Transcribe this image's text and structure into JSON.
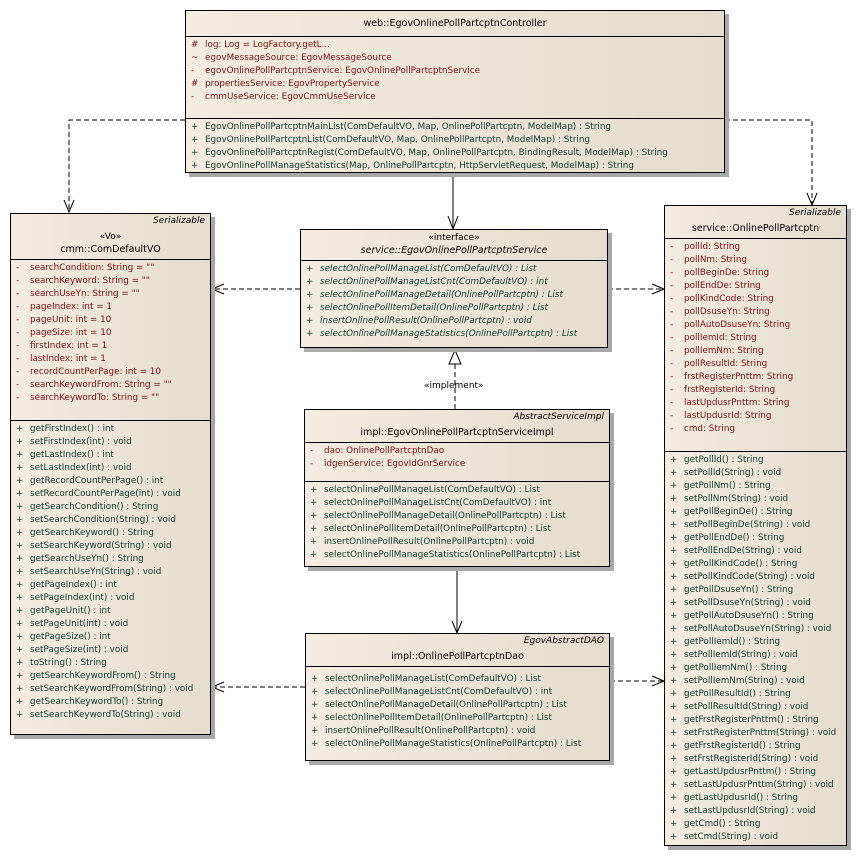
{
  "controller": {
    "name": "web::EgovOnlinePollPartcptnController",
    "attributes": [
      {
        "vis": "#",
        "text": "log:  Log = LogFactory.getL..."
      },
      {
        "vis": "~",
        "text": "egovMessageSource:  EgovMessageSource"
      },
      {
        "vis": "-",
        "text": "egovOnlinePollPartcptnService:  EgovOnlinePollPartcptnService"
      },
      {
        "vis": "#",
        "text": "propertiesService:  EgovPropertyService"
      },
      {
        "vis": "-",
        "text": "cmmUseService:  EgovCmmUseService"
      }
    ],
    "operations": [
      {
        "vis": "+",
        "text": "EgovOnlinePollPartcptnMainList(ComDefaultVO, Map, OnlinePollPartcptn, ModelMap) : String"
      },
      {
        "vis": "+",
        "text": "EgovOnlinePollPartcptnList(ComDefaultVO, Map, OnlinePollPartcptn, ModelMap) : String"
      },
      {
        "vis": "+",
        "text": "EgovOnlinePollPartcptnRegist(ComDefaultVO, Map, OnlinePollPartcptn, BindingResult, ModelMap) : String"
      },
      {
        "vis": "+",
        "text": "EgovOnlinePollManageStatistics(Map, OnlinePollPartcptn, HttpServletRequest, ModelMap) : String"
      }
    ]
  },
  "comDefaultVO": {
    "parent": "Serializable",
    "stereotype": "«Vo»",
    "name": "cmm::ComDefaultVO",
    "attributes": [
      {
        "vis": "-",
        "text": "searchCondition:  String = \"\""
      },
      {
        "vis": "-",
        "text": "searchKeyword:  String = \"\""
      },
      {
        "vis": "-",
        "text": "searchUseYn:  String = \"\""
      },
      {
        "vis": "-",
        "text": "pageIndex:  int = 1"
      },
      {
        "vis": "-",
        "text": "pageUnit:  int = 10"
      },
      {
        "vis": "-",
        "text": "pageSize:  int = 10"
      },
      {
        "vis": "-",
        "text": "firstIndex:  int = 1"
      },
      {
        "vis": "-",
        "text": "lastIndex:  int = 1"
      },
      {
        "vis": "-",
        "text": "recordCountPerPage:  int = 10"
      },
      {
        "vis": "-",
        "text": "searchKeywordFrom:  String = \"\""
      },
      {
        "vis": "-",
        "text": "searchKeywordTo:  String = \"\""
      }
    ],
    "operations": [
      {
        "vis": "+",
        "text": "getFirstIndex() : int"
      },
      {
        "vis": "+",
        "text": "setFirstIndex(int) : void"
      },
      {
        "vis": "+",
        "text": "getLastIndex() : int"
      },
      {
        "vis": "+",
        "text": "setLastIndex(int) : void"
      },
      {
        "vis": "+",
        "text": "getRecordCountPerPage() : int"
      },
      {
        "vis": "+",
        "text": "setRecordCountPerPage(int) : void"
      },
      {
        "vis": "+",
        "text": "getSearchCondition() : String"
      },
      {
        "vis": "+",
        "text": "setSearchCondition(String) : void"
      },
      {
        "vis": "+",
        "text": "getSearchKeyword() : String"
      },
      {
        "vis": "+",
        "text": "setSearchKeyword(String) : void"
      },
      {
        "vis": "+",
        "text": "getSearchUseYn() : String"
      },
      {
        "vis": "+",
        "text": "setSearchUseYn(String) : void"
      },
      {
        "vis": "+",
        "text": "getPageIndex() : int"
      },
      {
        "vis": "+",
        "text": "setPageIndex(int) : void"
      },
      {
        "vis": "+",
        "text": "getPageUnit() : int"
      },
      {
        "vis": "+",
        "text": "setPageUnit(int) : void"
      },
      {
        "vis": "+",
        "text": "getPageSize() : int"
      },
      {
        "vis": "+",
        "text": "setPageSize(int) : void"
      },
      {
        "vis": "+",
        "text": "toString() : String"
      },
      {
        "vis": "+",
        "text": "getSearchKeywordFrom() : String"
      },
      {
        "vis": "+",
        "text": "setSearchKeywordFrom(String) : void"
      },
      {
        "vis": "+",
        "text": "getSearchKeywordTo() : String"
      },
      {
        "vis": "+",
        "text": "setSearchKeywordTo(String) : void"
      }
    ]
  },
  "serviceInterface": {
    "stereotype": "«interface»",
    "name": "service::EgovOnlinePollPartcptnService",
    "operations": [
      {
        "vis": "+",
        "text": "selectOnlinePollManageList(ComDefaultVO) : List"
      },
      {
        "vis": "+",
        "text": "selectOnlinePollManageListCnt(ComDefaultVO) : int"
      },
      {
        "vis": "+",
        "text": "selectOnlinePollManageDetail(OnlinePollPartcptn) : List"
      },
      {
        "vis": "+",
        "text": "selectOnlinePollItemDetail(OnlinePollPartcptn) : List"
      },
      {
        "vis": "+",
        "text": "insertOnlinePollResult(OnlinePollPartcptn) : void"
      },
      {
        "vis": "+",
        "text": "selectOnlinePollManageStatistics(OnlinePollPartcptn) : List"
      }
    ]
  },
  "implementLabel": "«implement»",
  "serviceImpl": {
    "parent": "AbstractServiceImpl",
    "name": "impl::EgovOnlinePollPartcptnServiceImpl",
    "attributes": [
      {
        "vis": "-",
        "text": "dao:  OnlinePollPartcptnDao"
      },
      {
        "vis": "-",
        "text": "idgenService:  EgovIdGnrService"
      }
    ],
    "operations": [
      {
        "vis": "+",
        "text": "selectOnlinePollManageList(ComDefaultVO) : List"
      },
      {
        "vis": "+",
        "text": "selectOnlinePollManageListCnt(ComDefaultVO) : int"
      },
      {
        "vis": "+",
        "text": "selectOnlinePollManageDetail(OnlinePollPartcptn) : List"
      },
      {
        "vis": "+",
        "text": "selectOnlinePollItemDetail(OnlinePollPartcptn) : List"
      },
      {
        "vis": "+",
        "text": "insertOnlinePollResult(OnlinePollPartcptn) : void"
      },
      {
        "vis": "+",
        "text": "selectOnlinePollManageStatistics(OnlinePollPartcptn) : List"
      }
    ]
  },
  "dao": {
    "parent": "EgovAbstractDAO",
    "name": "impl::OnlinePollPartcptnDao",
    "operations": [
      {
        "vis": "+",
        "text": "selectOnlinePollManageList(ComDefaultVO) : List"
      },
      {
        "vis": "+",
        "text": "selectOnlinePollManageListCnt(ComDefaultVO) : int"
      },
      {
        "vis": "+",
        "text": "selectOnlinePollManageDetail(OnlinePollPartcptn) : List"
      },
      {
        "vis": "+",
        "text": "selectOnlinePollItemDetail(OnlinePollPartcptn) : List"
      },
      {
        "vis": "+",
        "text": "insertOnlinePollResult(OnlinePollPartcptn) : void"
      },
      {
        "vis": "+",
        "text": "selectOnlinePollManageStatistics(OnlinePollPartcptn) : List"
      }
    ]
  },
  "pollPartcptn": {
    "parent": "Serializable",
    "name": "service::OnlinePollPartcptn",
    "attributes": [
      {
        "vis": "-",
        "text": "pollId:  String"
      },
      {
        "vis": "-",
        "text": "pollNm:  String"
      },
      {
        "vis": "-",
        "text": "pollBeginDe:  String"
      },
      {
        "vis": "-",
        "text": "pollEndDe:  String"
      },
      {
        "vis": "-",
        "text": "pollKindCode:  String"
      },
      {
        "vis": "-",
        "text": "pollDsuseYn:  String"
      },
      {
        "vis": "-",
        "text": "pollAutoDsuseYn:  String"
      },
      {
        "vis": "-",
        "text": "pollIemId:  String"
      },
      {
        "vis": "-",
        "text": "pollIemNm:  String"
      },
      {
        "vis": "-",
        "text": "pollResultId:  String"
      },
      {
        "vis": "-",
        "text": "frstRegisterPnttm:  String"
      },
      {
        "vis": "-",
        "text": "frstRegisterId:  String"
      },
      {
        "vis": "-",
        "text": "lastUpdusrPnttm:  String"
      },
      {
        "vis": "-",
        "text": "lastUpdusrId:  String"
      },
      {
        "vis": "-",
        "text": "cmd:  String"
      }
    ],
    "operations": [
      {
        "vis": "+",
        "text": "getPollId() : String"
      },
      {
        "vis": "+",
        "text": "setPollId(String) : void"
      },
      {
        "vis": "+",
        "text": "getPollNm() : String"
      },
      {
        "vis": "+",
        "text": "setPollNm(String) : void"
      },
      {
        "vis": "+",
        "text": "getPollBeginDe() : String"
      },
      {
        "vis": "+",
        "text": "setPollBeginDe(String) : void"
      },
      {
        "vis": "+",
        "text": "getPollEndDe() : String"
      },
      {
        "vis": "+",
        "text": "setPollEndDe(String) : void"
      },
      {
        "vis": "+",
        "text": "getPollKindCode() : String"
      },
      {
        "vis": "+",
        "text": "setPollKindCode(String) : void"
      },
      {
        "vis": "+",
        "text": "getPollDsuseYn() : String"
      },
      {
        "vis": "+",
        "text": "setPollDsuseYn(String) : void"
      },
      {
        "vis": "+",
        "text": "getPollAutoDsuseYn() : String"
      },
      {
        "vis": "+",
        "text": "setPollAutoDsuseYn(String) : void"
      },
      {
        "vis": "+",
        "text": "getPollIemId() : String"
      },
      {
        "vis": "+",
        "text": "setPollIemId(String) : void"
      },
      {
        "vis": "+",
        "text": "getPollIemNm() : String"
      },
      {
        "vis": "+",
        "text": "setPollIemNm(String) : void"
      },
      {
        "vis": "+",
        "text": "getPollResultId() : String"
      },
      {
        "vis": "+",
        "text": "setPollResultId(String) : void"
      },
      {
        "vis": "+",
        "text": "getFrstRegisterPnttm() : String"
      },
      {
        "vis": "+",
        "text": "setFrstRegisterPnttm(String) : void"
      },
      {
        "vis": "+",
        "text": "getFrstRegisterId() : String"
      },
      {
        "vis": "+",
        "text": "setFrstRegisterId(String) : void"
      },
      {
        "vis": "+",
        "text": "getLastUpdusrPnttm() : String"
      },
      {
        "vis": "+",
        "text": "setLastUpdusrPnttm(String) : void"
      },
      {
        "vis": "+",
        "text": "getLastUpdusrId() : String"
      },
      {
        "vis": "+",
        "text": "setLastUpdusrId(String) : void"
      },
      {
        "vis": "+",
        "text": "getCmd() : String"
      },
      {
        "vis": "+",
        "text": "setCmd(String) : void"
      }
    ]
  }
}
